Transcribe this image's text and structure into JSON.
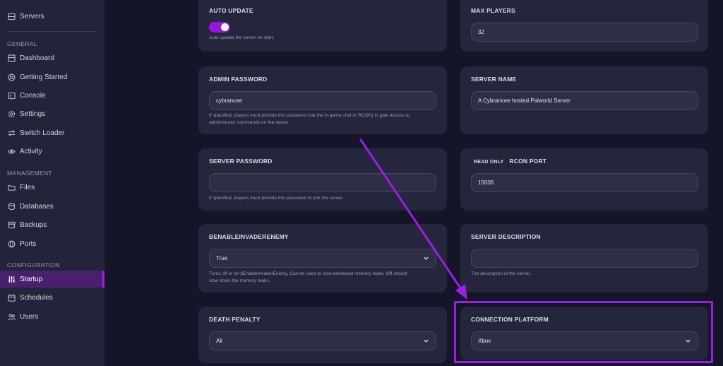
{
  "sidebar": {
    "servers_label": "Servers",
    "sections": {
      "general": "GENERAL",
      "management": "MANAGEMENT",
      "configuration": "CONFIGURATION"
    },
    "items": {
      "dashboard": "Dashboard",
      "getting_started": "Getting Started",
      "console": "Console",
      "settings": "Settings",
      "switch_loader": "Switch Loader",
      "activity": "Activity",
      "files": "Files",
      "databases": "Databases",
      "backups": "Backups",
      "ports": "Ports",
      "startup": "Startup",
      "schedules": "Schedules",
      "users": "Users"
    },
    "active_item": "Startup"
  },
  "cards": {
    "auto_update": {
      "title": "AUTO UPDATE",
      "toggle_on": true,
      "help": "Auto update the server on start."
    },
    "max_players": {
      "title": "MAX PLAYERS",
      "value": "32"
    },
    "admin_password": {
      "title": "ADMIN PASSWORD",
      "value": "cybrancee",
      "help_line1": "If specified, players must provide this password (via the in-game chat or RCON) to gain access to",
      "help_line2": "administrator commands on the server."
    },
    "server_name": {
      "title": "SERVER NAME",
      "value": "A Cybrancee hosted Palworld Server"
    },
    "server_password": {
      "title": "SERVER PASSWORD",
      "value": "",
      "help": "If specified, players must provide this password to join the server."
    },
    "rcon_port": {
      "badge": "READ ONLY",
      "title": "RCON PORT",
      "value": "15006"
    },
    "benable_invader_enemy": {
      "title": "BENABLEINVADERENEMY",
      "selected": "True",
      "help_line1": "Turns off or on bEnableInvaderEnemy, Can be used to slow download memory leaks. Off should",
      "help_line2": "slow down the memory leaks."
    },
    "server_description": {
      "title": "SERVER DESCRIPTION",
      "value": "",
      "help": "The description of the server."
    },
    "death_penalty": {
      "title": "DEATH PENALTY",
      "selected": "All"
    },
    "connection_platform": {
      "title": "CONNECTION PLATFORM",
      "selected": "Xbox"
    }
  },
  "colors": {
    "accent": "#9b1de6",
    "card_bg": "#25253b",
    "sidebar_bg": "#23233a",
    "page_bg": "#15152a"
  }
}
